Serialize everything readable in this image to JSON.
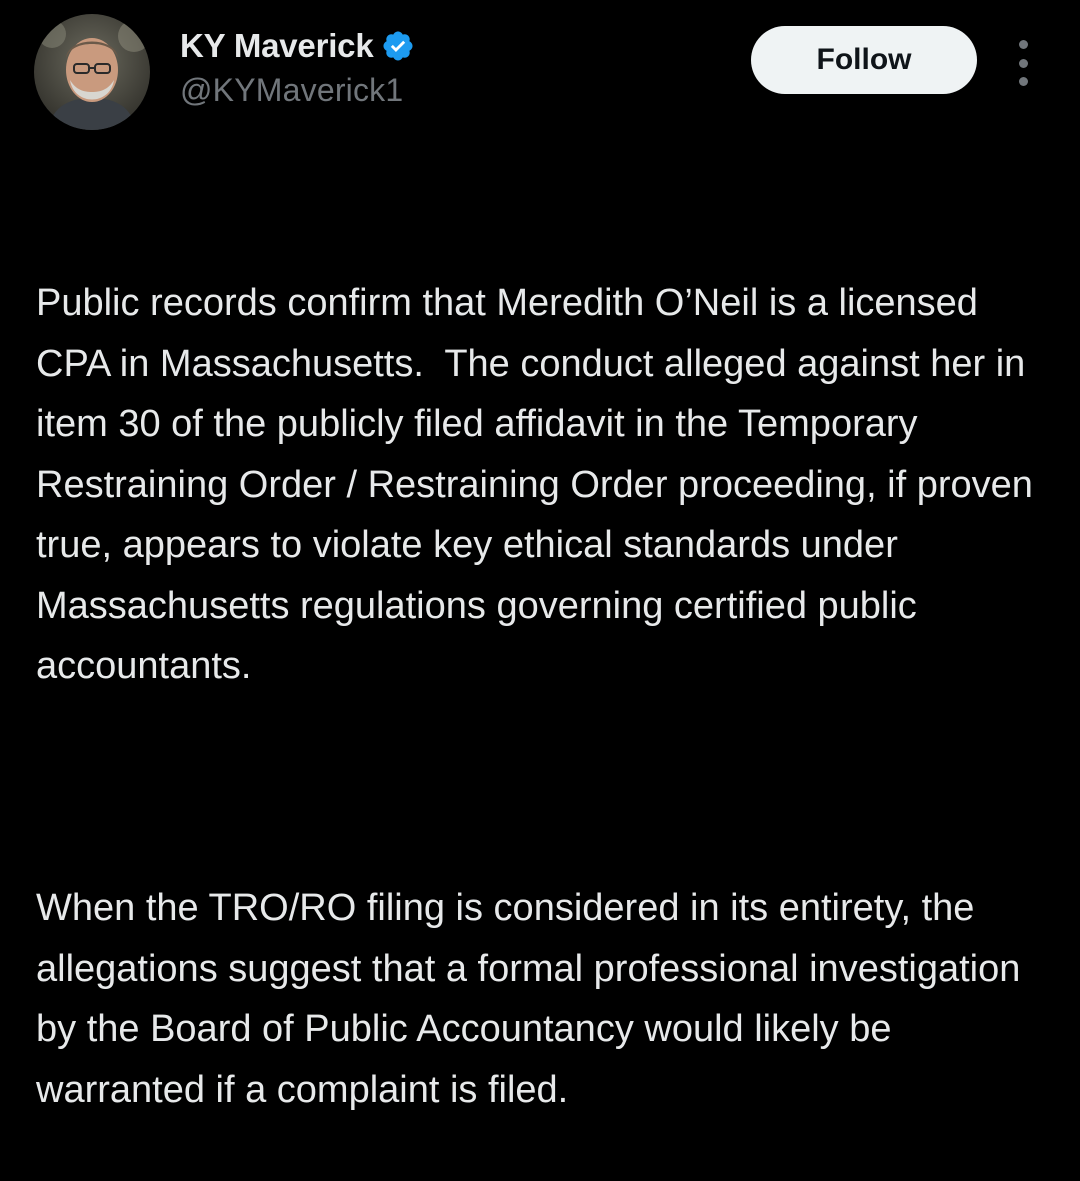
{
  "author": {
    "display_name": "KY Maverick",
    "handle": "@KYMaverick1",
    "verified": true,
    "avatar_icon": "user-avatar-photo",
    "verified_icon": "verified-badge-icon",
    "verified_color": "#1d9bf0"
  },
  "actions": {
    "follow_label": "Follow",
    "more_icon": "more-options-icon"
  },
  "tweet": {
    "paragraphs": [
      "Public records confirm that Meredith O’Neil is a licensed CPA in Massachusetts.  The conduct alleged against her in item 30 of the publicly filed affidavit in the Temporary Restraining Order / Restraining Order proceeding, if proven true, appears to violate key ethical standards under Massachusetts regulations governing certified public accountants.",
      "When the TRO/RO filing is considered in its entirety, the allegations suggest that a formal professional investigation by the Board of Public Accountancy would likely be warranted if a complaint is filed."
    ]
  },
  "colors": {
    "background": "#000000",
    "text": "#e7e9ea",
    "secondary_text": "#71767b",
    "button_bg": "#eff3f4",
    "button_text": "#0f1419"
  }
}
